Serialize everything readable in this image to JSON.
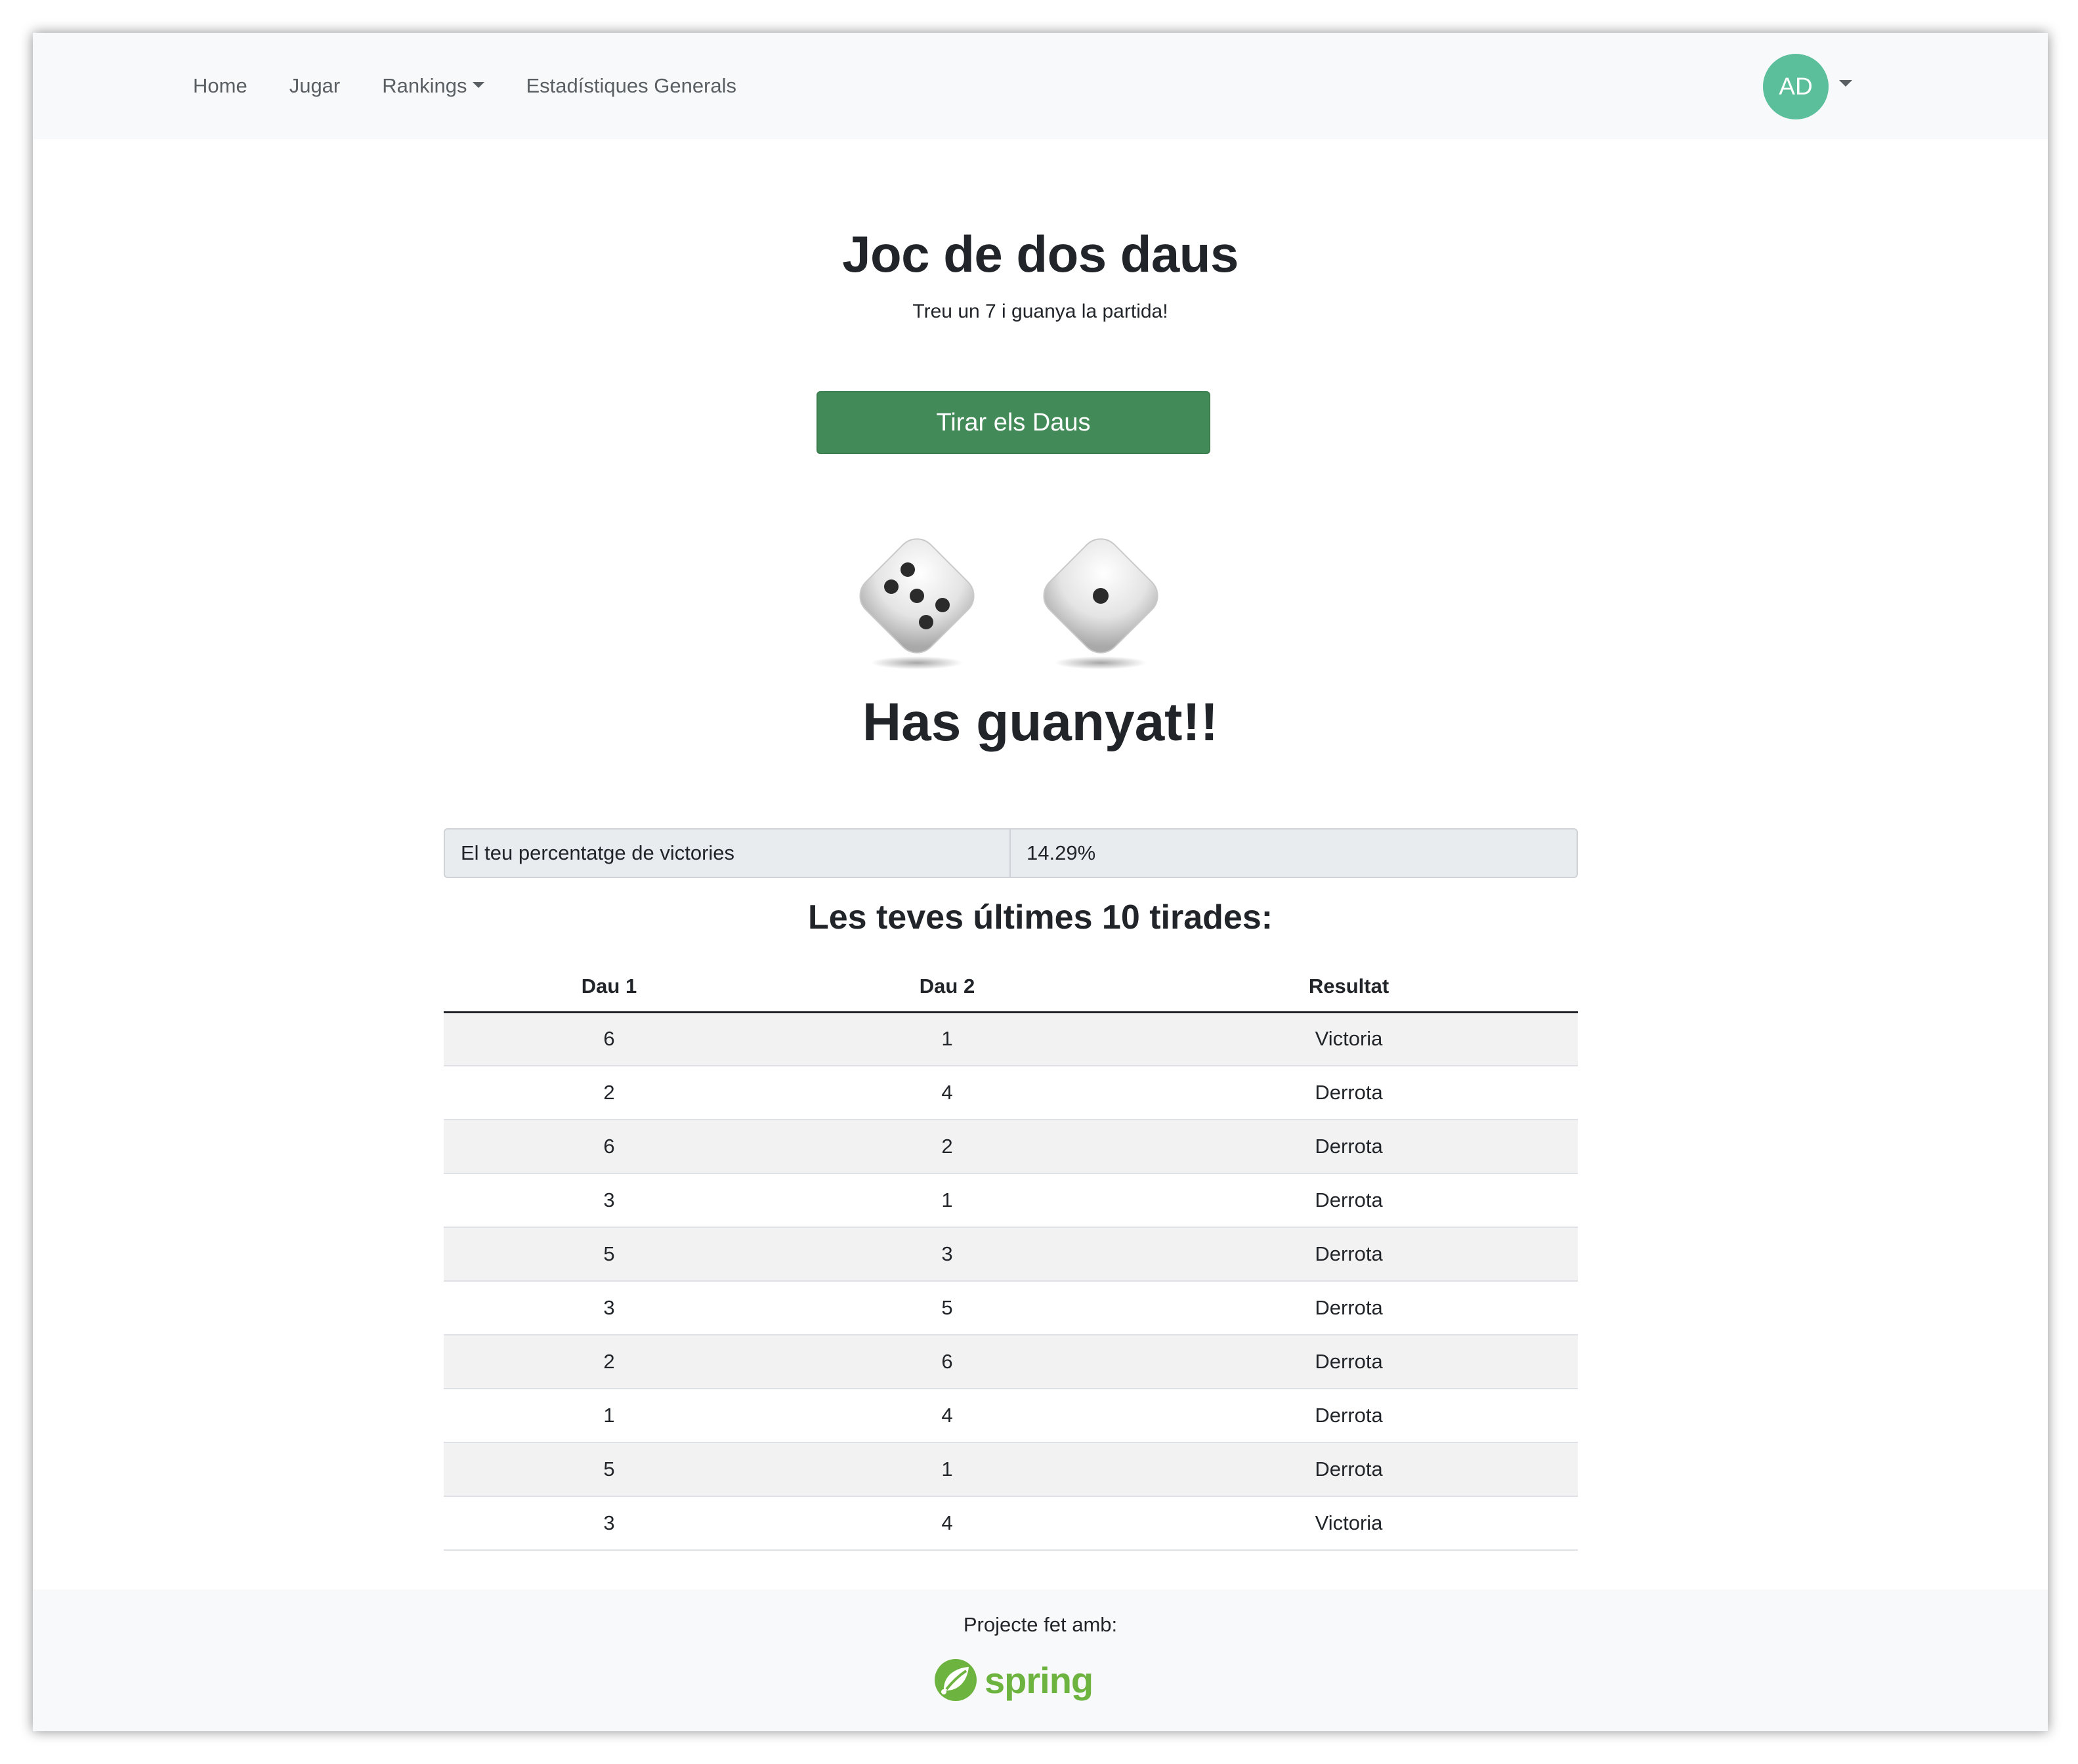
{
  "nav": {
    "items": [
      {
        "label": "Home"
      },
      {
        "label": "Jugar"
      },
      {
        "label": "Rankings",
        "has_dropdown": true
      },
      {
        "label": "Estadístiques Generals"
      }
    ],
    "user": {
      "initials": "AD",
      "avatar_color": "#5bbf9c"
    }
  },
  "game": {
    "title": "Joc de dos daus",
    "subtitle": "Treu un 7 i guanya la partida!",
    "roll_button_label": "Tirar els Daus",
    "button_color": "#428a58",
    "dice": [
      5,
      1
    ],
    "result_message": "Has guanyat!!"
  },
  "stats": {
    "percentage_label": "El teu percentatge de victories",
    "percentage_value": "14.29%"
  },
  "history": {
    "title": "Les teves últimes 10 tirades:",
    "columns": [
      "Dau 1",
      "Dau 2",
      "Resultat"
    ],
    "rows": [
      [
        "6",
        "1",
        "Victoria"
      ],
      [
        "2",
        "4",
        "Derrota"
      ],
      [
        "6",
        "2",
        "Derrota"
      ],
      [
        "3",
        "1",
        "Derrota"
      ],
      [
        "5",
        "3",
        "Derrota"
      ],
      [
        "3",
        "5",
        "Derrota"
      ],
      [
        "2",
        "6",
        "Derrota"
      ],
      [
        "1",
        "4",
        "Derrota"
      ],
      [
        "5",
        "1",
        "Derrota"
      ],
      [
        "3",
        "4",
        "Victoria"
      ]
    ]
  },
  "footer": {
    "text": "Projecte fet amb:",
    "logo_text": "spring",
    "logo_color": "#6db33f"
  }
}
